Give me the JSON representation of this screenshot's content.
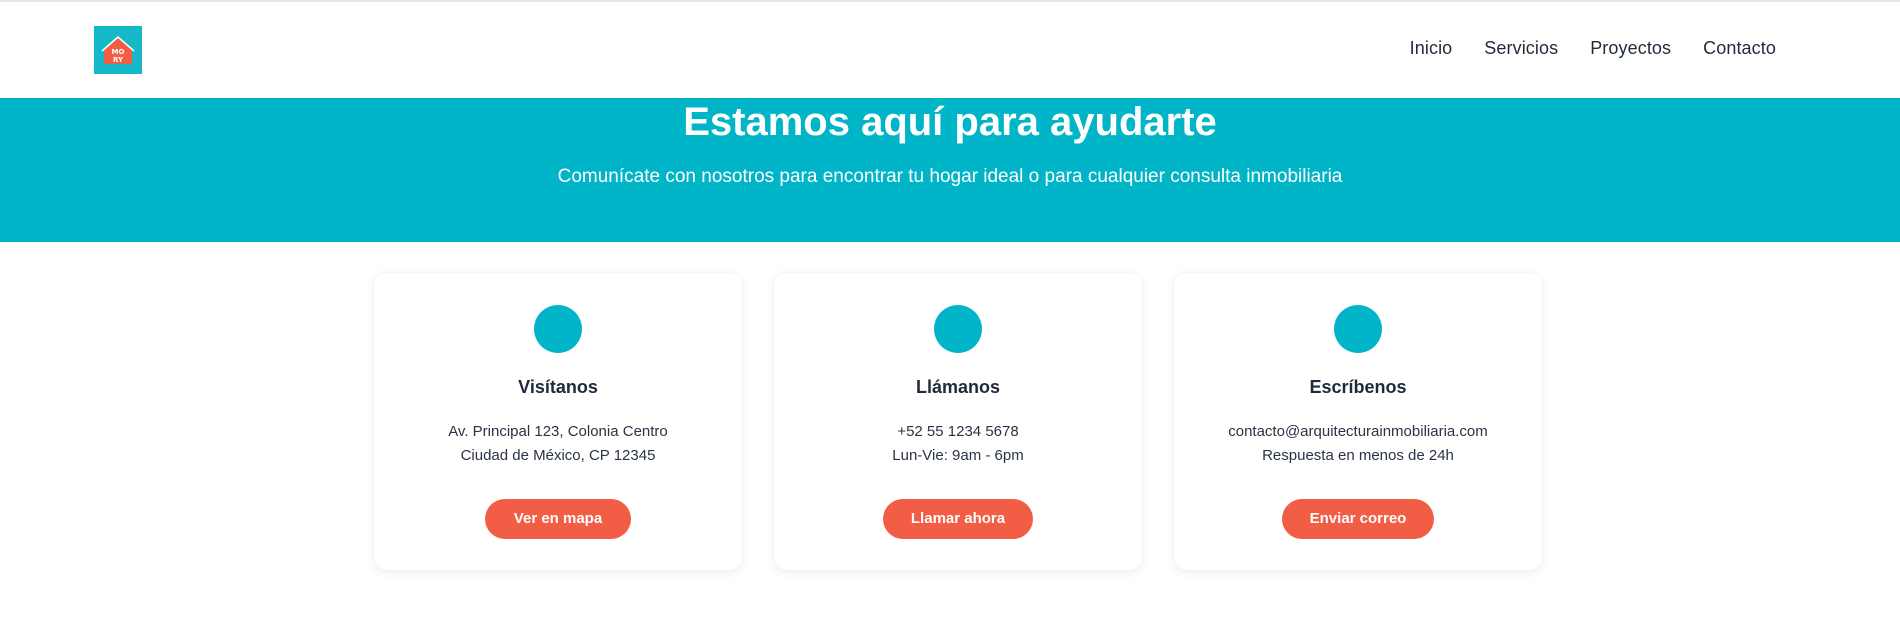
{
  "header": {
    "logo_text_top": "MO",
    "logo_text_bottom": "RY",
    "nav": [
      {
        "label": "Inicio"
      },
      {
        "label": "Servicios"
      },
      {
        "label": "Proyectos"
      },
      {
        "label": "Contacto"
      }
    ]
  },
  "hero": {
    "title": "Estamos aquí para ayudarte",
    "subtitle": "Comunícate con nosotros para encontrar tu hogar ideal o para cualquier consulta inmobiliaria"
  },
  "cards": [
    {
      "title": "Visítanos",
      "line1": "Av. Principal 123, Colonia Centro",
      "line2": "Ciudad de México, CP 12345",
      "button": "Ver en mapa"
    },
    {
      "title": "Llámanos",
      "line1": "+52 55 1234 5678",
      "line2": "Lun-Vie: 9am - 6pm",
      "button": "Llamar ahora"
    },
    {
      "title": "Escríbenos",
      "line1": "contacto@arquitecturainmobiliaria.com",
      "line2": "Respuesta en menos de 24h",
      "button": "Enviar correo"
    }
  ],
  "colors": {
    "accent_teal": "#00b5c8",
    "button_coral": "#f25d45",
    "text_dark": "#1f2a3a"
  }
}
